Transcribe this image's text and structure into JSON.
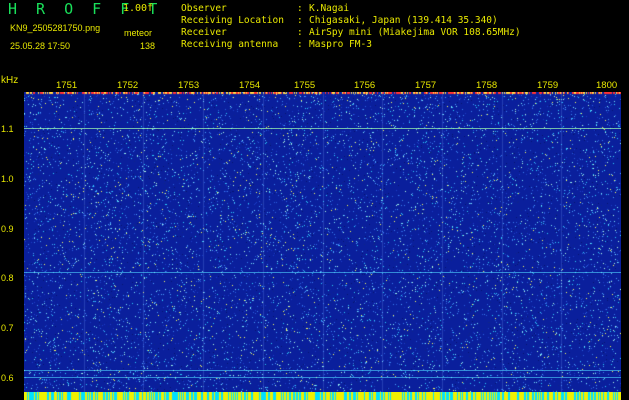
{
  "header": {
    "app_title": "H R O F F T",
    "version": "1.00f",
    "filename": "KN9_2505281750.png",
    "detection_label": "meteor",
    "datetime": "25.05.28 17:50",
    "count": "138"
  },
  "info": [
    {
      "label": "Observer",
      "value": "K.Nagai"
    },
    {
      "label": "Receiving Location",
      "value": "Chigasaki, Japan (139.414 35.340)"
    },
    {
      "label": "Receiver",
      "value": "AirSpy mini (Miakejima VOR 108.65MHz)"
    },
    {
      "label": "Receiving antenna",
      "value": "Maspro FM-3"
    }
  ],
  "chart_data": {
    "type": "heatmap",
    "ylabel": "kHz",
    "y_ticks": [
      "1.1",
      "1.0",
      "0.9",
      "0.8",
      "0.7",
      "0.6"
    ],
    "x_ticks": [
      "1751",
      "1752",
      "1753",
      "1754",
      "1755",
      "1756",
      "1757",
      "1758",
      "1759",
      "1800"
    ],
    "ylim": [
      0.58,
      1.17
    ],
    "colors": {
      "background": "#0a1f9c",
      "noise": "#3aa0ff",
      "signal": "#e8e800",
      "cyan": "#00ffff",
      "red": "#ff2020"
    }
  }
}
